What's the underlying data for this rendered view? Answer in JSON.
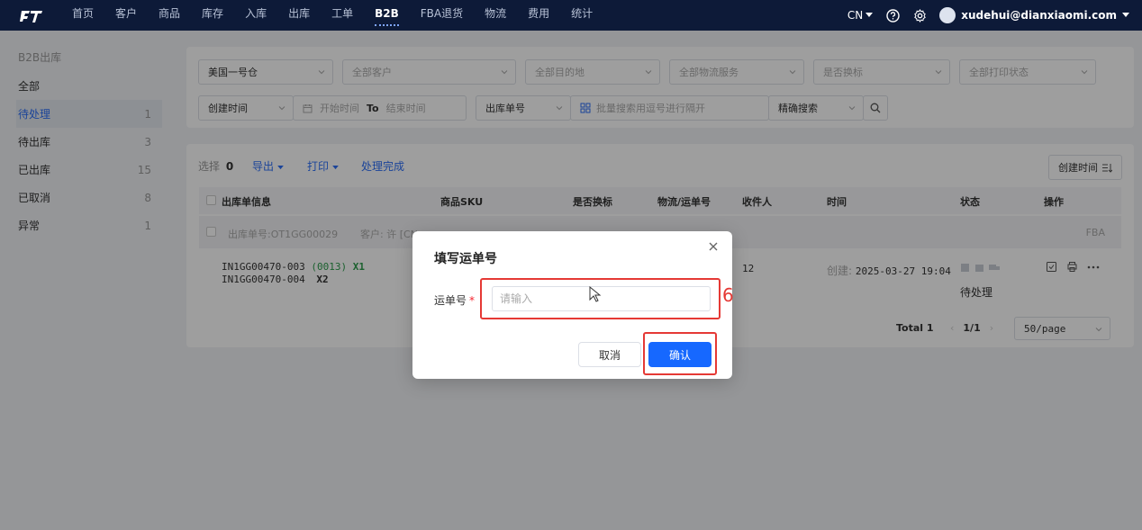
{
  "nav": {
    "items": [
      "首页",
      "客户",
      "商品",
      "库存",
      "入库",
      "出库",
      "工单",
      "B2B",
      "FBA退货",
      "物流",
      "费用",
      "统计"
    ],
    "active_index": 7,
    "lang": "CN",
    "user_email": "xudehui@dianxiaomi.com"
  },
  "sidebar": {
    "title": "B2B出库",
    "items": [
      {
        "label": "全部",
        "count": ""
      },
      {
        "label": "待处理",
        "count": "1"
      },
      {
        "label": "待出库",
        "count": "3"
      },
      {
        "label": "已出库",
        "count": "15"
      },
      {
        "label": "已取消",
        "count": "8"
      },
      {
        "label": "异常",
        "count": "1"
      }
    ]
  },
  "filters": {
    "warehouse": "美国一号仓",
    "customer": "全部客户",
    "destination": "全部目的地",
    "logistics_service": "全部物流服务",
    "label_change": "是否换标",
    "print_status": "全部打印状态",
    "time_type": "创建时间",
    "start_time": "开始时间",
    "to_label": "To",
    "end_time": "结束时间",
    "number_type": "出库单号",
    "batch_search": "批量搜索用逗号进行隔开",
    "search_mode": "精确搜索"
  },
  "toolbar": {
    "selected_label": "选择",
    "selected_count": "0",
    "export": "导出",
    "print": "打印",
    "done": "处理完成",
    "sort": "创建时间"
  },
  "table": {
    "headers": [
      "出库单信息",
      "商品SKU",
      "是否换标",
      "物流/运单号",
      "收件人",
      "时间",
      "状态",
      "操作"
    ],
    "group": {
      "order_no": "出库单号:OT1GG00029",
      "customer": "客户: 许 [CN",
      "tag": "FBA"
    },
    "row": {
      "line1_code": "IN1GG00470-003",
      "line1_qty": "(0013)",
      "line1_mult": "X1",
      "line2_code": "IN1GG00470-004",
      "line2_mult": "X2",
      "recipient": "12",
      "created_label": "创建:",
      "created_time": "2025-03-27 19:04",
      "status": "待处理"
    }
  },
  "pagination": {
    "total": "Total 1",
    "page": "1/1",
    "per_page": "50/page"
  },
  "modal": {
    "title": "填写运单号",
    "field_label": "运单号",
    "required_mark": "*",
    "placeholder": "请输入",
    "cancel": "取消",
    "confirm": "确认"
  },
  "annotation": {
    "step": "6",
    "color": "#e53935"
  }
}
